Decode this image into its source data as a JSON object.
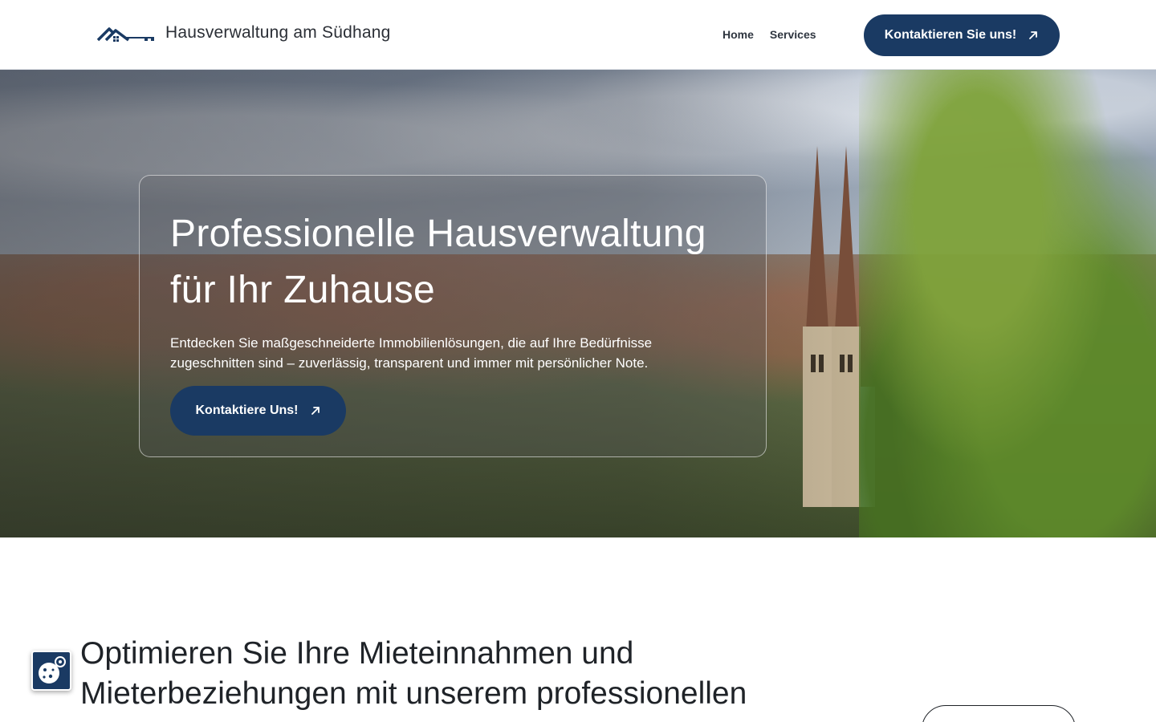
{
  "header": {
    "brand_name": "Hausverwaltung am Südhang",
    "logo_icon": "house-key-logo-icon",
    "nav": [
      {
        "label": "Home"
      },
      {
        "label": "Services"
      }
    ],
    "cta_label": "Kontaktieren Sie uns!",
    "cta_icon": "arrow-up-right-icon"
  },
  "hero": {
    "title": "Professionelle Hausverwaltung für Ihr Zuhause",
    "text": "Entdecken Sie maßgeschneiderte Immobilienlösungen, die auf Ihre Bedürfnisse zugeschnitten sind – zuverlässig, transparent und immer mit persönlicher Note.",
    "button_label": "Kontaktiere Uns!",
    "button_icon": "arrow-up-right-icon"
  },
  "section": {
    "title": "Optimieren Sie Ihre Mieteinnahmen und Mieterbeziehungen mit unserem professionellen"
  },
  "cookie": {
    "icon": "cookie-settings-icon"
  },
  "colors": {
    "primary": "#1a3a63",
    "text": "#1f2328",
    "white": "#ffffff"
  }
}
